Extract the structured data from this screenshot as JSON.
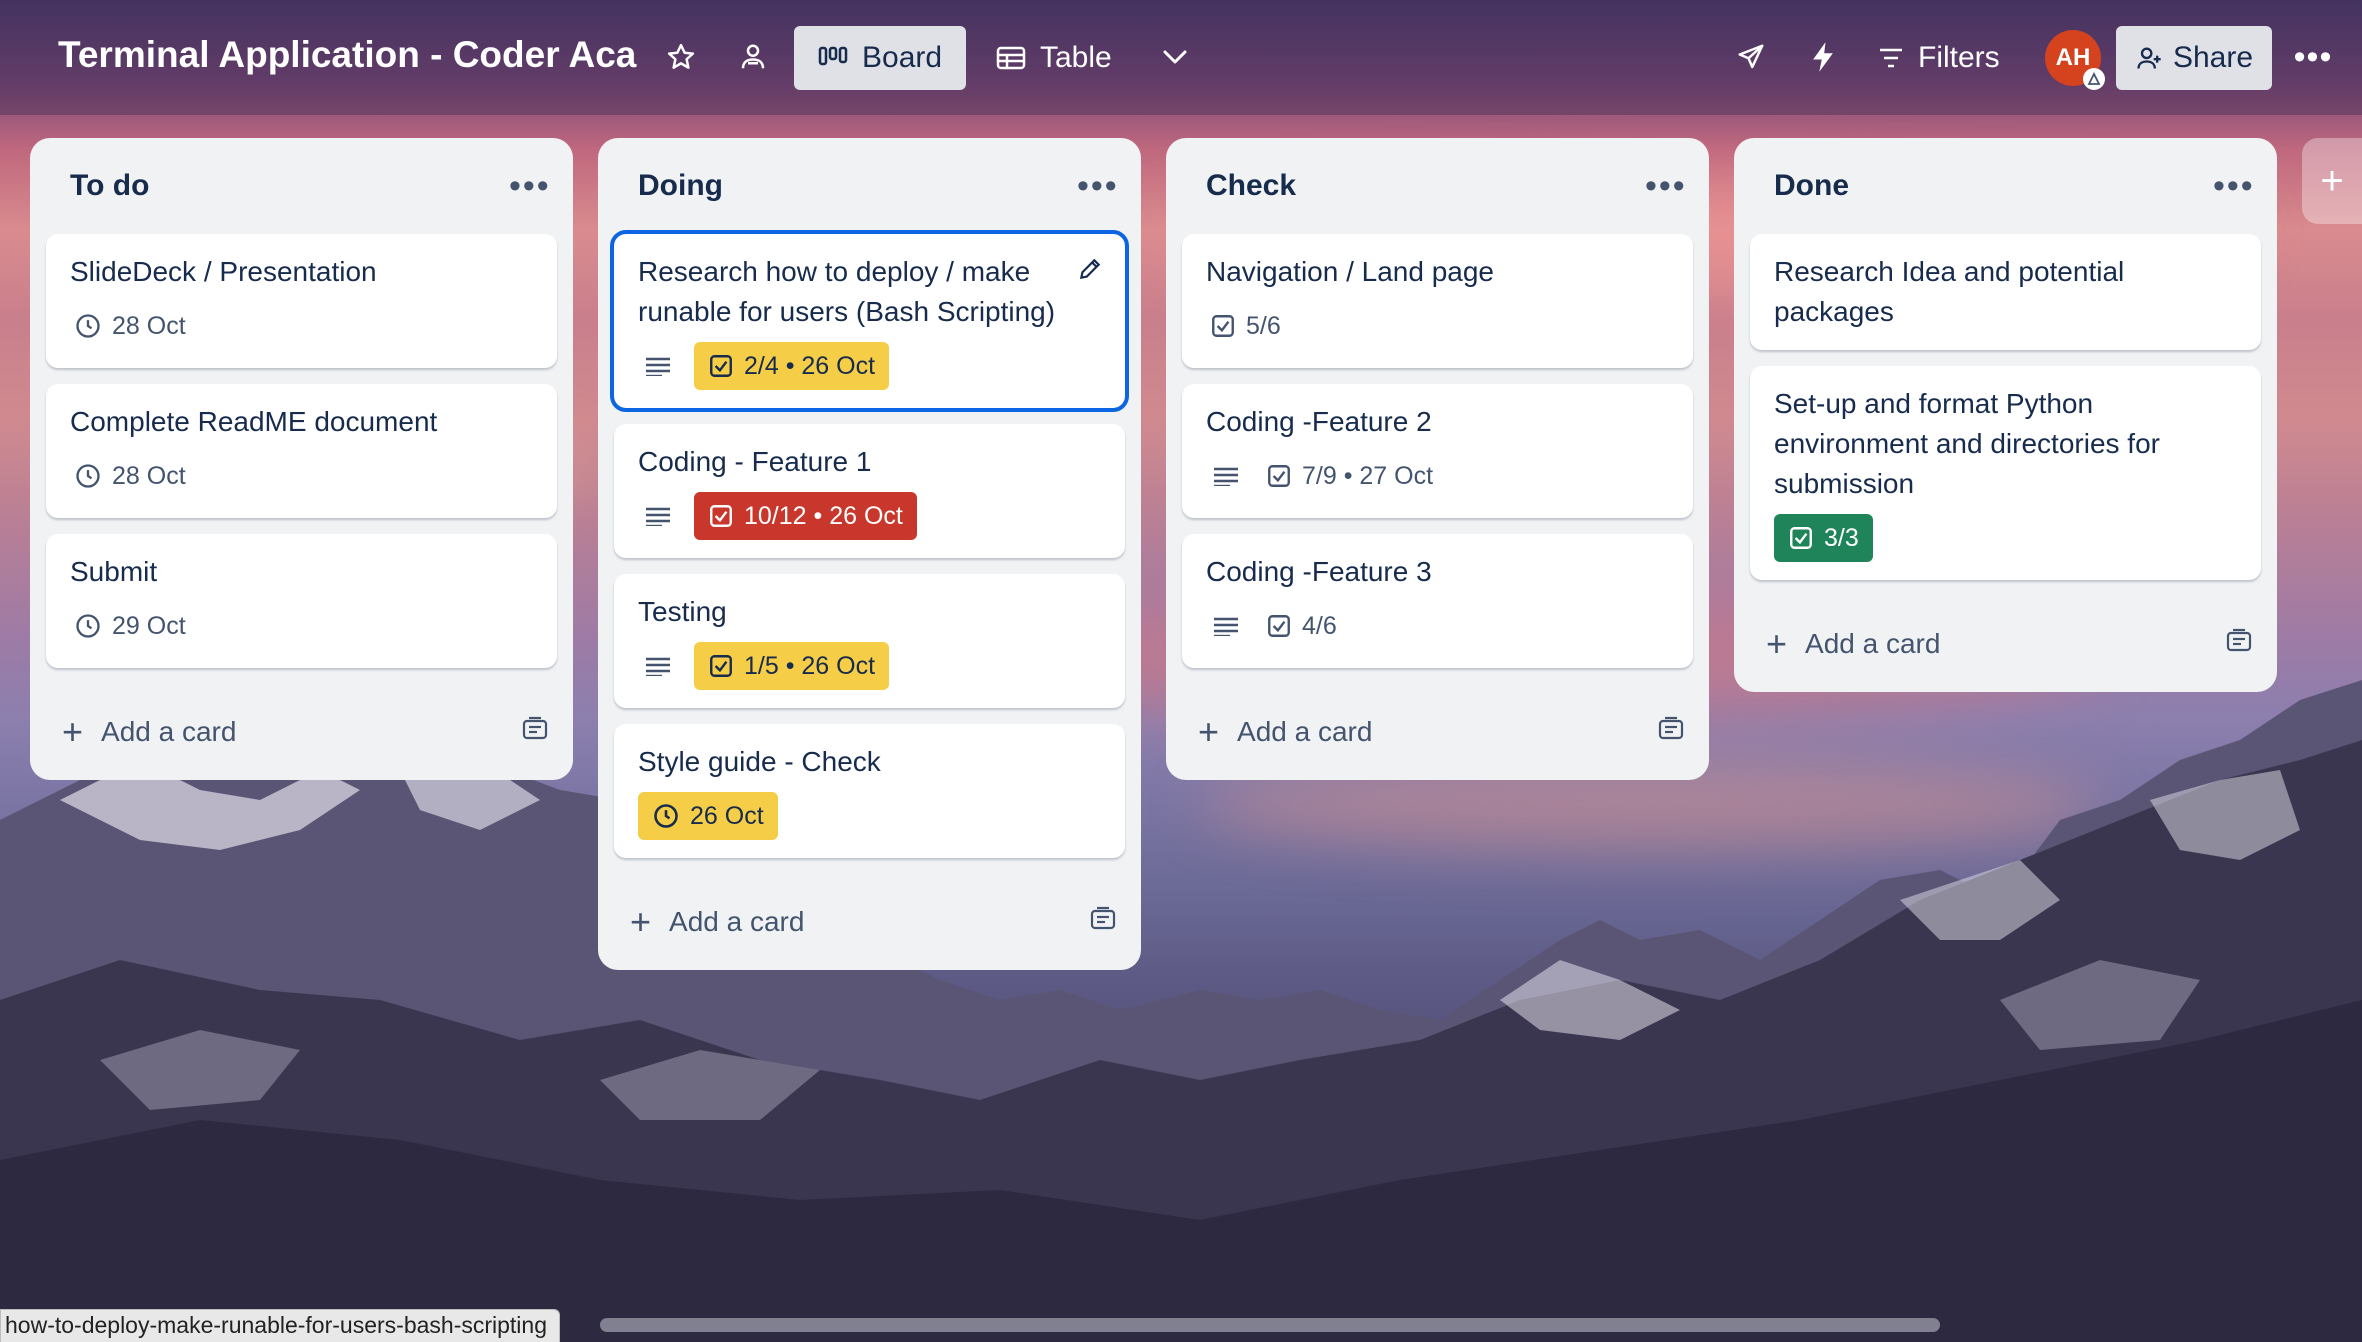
{
  "header": {
    "board_title": "Terminal Application - Coder Aca",
    "views": [
      {
        "label": "Board",
        "icon": "board-icon",
        "active": true
      },
      {
        "label": "Table",
        "icon": "table-icon",
        "active": false
      }
    ],
    "filters_label": "Filters",
    "avatar_initials": "AH",
    "share_label": "Share"
  },
  "lists": [
    {
      "title": "To do",
      "add_label": "Add a card",
      "cards": [
        {
          "title": "SlideDeck / Presentation",
          "due": "28 Oct"
        },
        {
          "title": "Complete ReadME document",
          "due": "28 Oct"
        },
        {
          "title": "Submit",
          "due": "29 Oct"
        }
      ]
    },
    {
      "title": "Doing",
      "add_label": "Add a card",
      "cards": [
        {
          "title": "Research how to deploy / make runable for users (Bash Scripting)",
          "badge": "2/4 • 26 Oct",
          "badge_color": "#f5cd47"
        },
        {
          "title": "Coding - Feature 1",
          "badge": "10/12 • 26 Oct",
          "badge_color": "#c9372c"
        },
        {
          "title": "Testing",
          "badge": "1/5 • 26 Oct",
          "badge_color": "#f5cd47"
        },
        {
          "title": "Style guide - Check",
          "due": "26 Oct",
          "badge_color": "#f5cd47"
        }
      ]
    },
    {
      "title": "Check",
      "add_label": "Add a card",
      "cards": [
        {
          "title": "Navigation / Land page",
          "checklist": "5/6"
        },
        {
          "title": "Coding -Feature 2",
          "checklist": "7/9 • 27 Oct"
        },
        {
          "title": "Coding -Feature 3",
          "checklist": "4/6"
        }
      ]
    },
    {
      "title": "Done",
      "add_label": "Add a card",
      "cards": [
        {
          "title": "Research Idea and potential packages"
        },
        {
          "title": "Set-up and format Python environment and directories for submission",
          "badge": "3/3",
          "badge_color": "#1f845a"
        }
      ]
    }
  ],
  "status_url": "how-to-deploy-make-runable-for-users-bash-scripting"
}
